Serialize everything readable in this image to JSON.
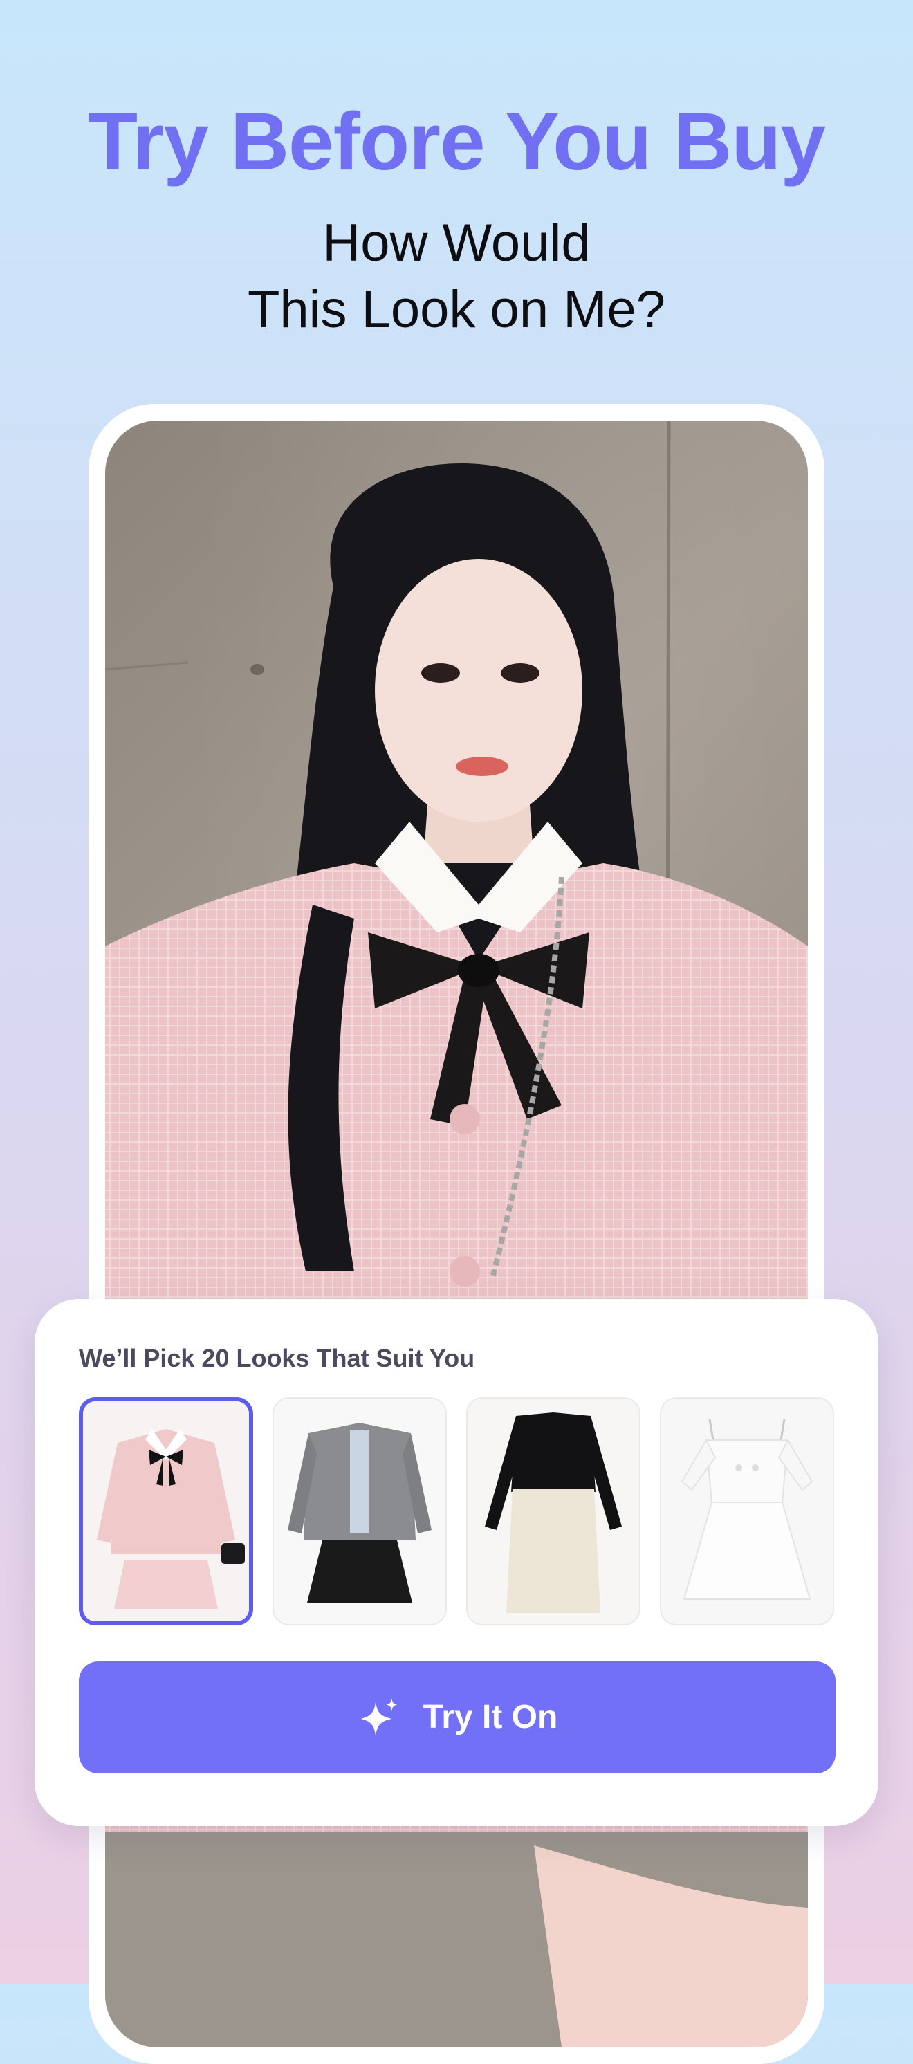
{
  "header": {
    "headline": "Try Before You Buy",
    "subline_1": "How Would",
    "subline_2": "This Look on Me?"
  },
  "card": {
    "title": "We’ll Pick 20 Looks That Suit You",
    "outfits": [
      {
        "name": "pink tweed jacket with bow and pleated skirt",
        "selected": true
      },
      {
        "name": "grey tweed cardigan with black pleated skirt",
        "selected": false
      },
      {
        "name": "black long-sleeve top with cream midi skirt",
        "selected": false
      },
      {
        "name": "white square-neck pleated dress",
        "selected": false
      }
    ],
    "cta_label": "Try It On",
    "cta_icon": "sparkle-icon"
  },
  "colors": {
    "accent": "#7170f2",
    "button": "#7170f7",
    "selected_border": "#5d5bf0",
    "card_title": "#4a4b5e"
  }
}
